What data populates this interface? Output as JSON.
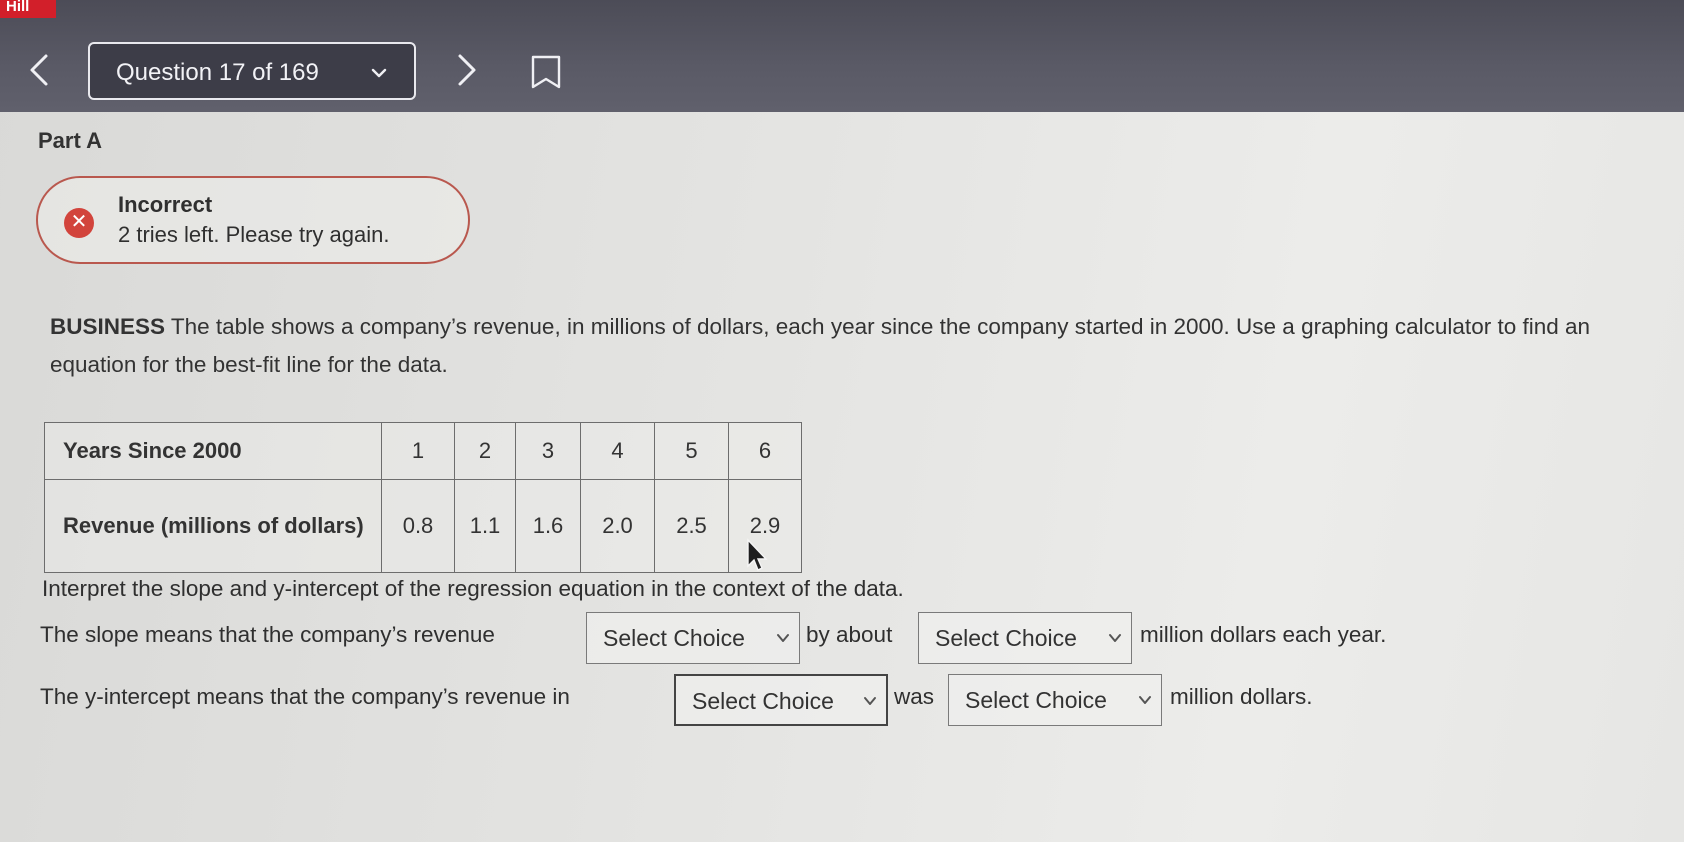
{
  "brand": {
    "label": "Hill"
  },
  "nav": {
    "question_label": "Question 17 of 169"
  },
  "part": {
    "title": "Part A"
  },
  "feedback": {
    "status": "Incorrect",
    "message": "2 tries left. Please try again."
  },
  "prompt": {
    "lead": "BUSINESS",
    "text": "The table shows a company’s revenue, in millions of dollars, each year since the company started in 2000. Use a graphing calculator to find an equation for the best-fit line for the data."
  },
  "table": {
    "row_labels": [
      "Years Since 2000",
      "Revenue (millions of dollars)"
    ],
    "years": [
      "1",
      "2",
      "3",
      "4",
      "5",
      "6"
    ],
    "revenue": [
      "0.8",
      "1.1",
      "1.6",
      "2.0",
      "2.5",
      "2.9"
    ]
  },
  "interpret": {
    "text": "Interpret the slope and y-intercept of the regression equation in the context of the data."
  },
  "slope_sentence": {
    "part1": "The slope means that the company’s revenue",
    "part2": "by about",
    "part3": "million dollars each year.",
    "choice1": "Select Choice",
    "choice2": "Select Choice"
  },
  "intercept_sentence": {
    "part1": "The y-intercept means that the company’s revenue in",
    "part2": "was",
    "part3": "million dollars.",
    "choice1": "Select Choice",
    "choice2": "Select Choice"
  },
  "colors": {
    "topbar": "#555560",
    "error": "#d2443c",
    "brand": "#d21f2a"
  }
}
